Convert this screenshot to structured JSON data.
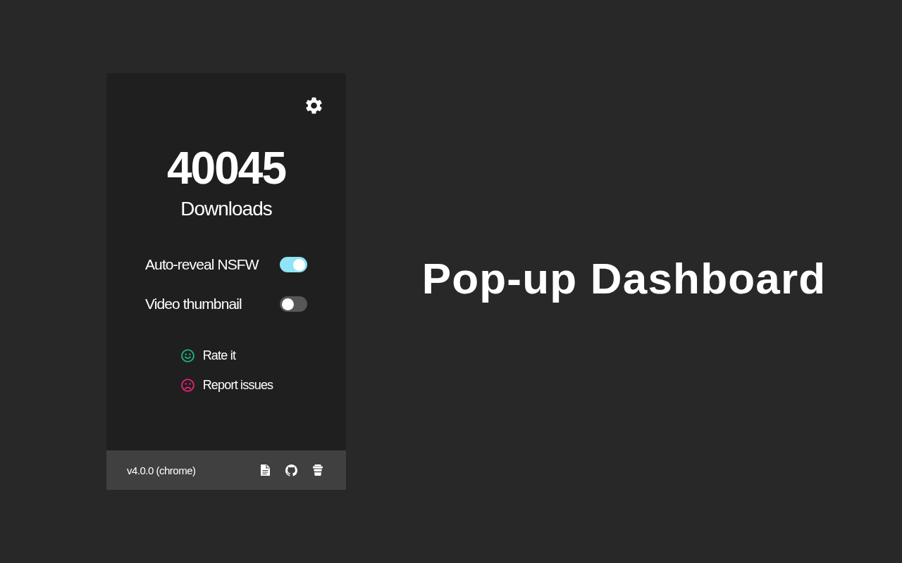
{
  "panel": {
    "count": "40045",
    "count_label": "Downloads",
    "toggles": [
      {
        "label": "Auto-reveal NSFW",
        "on": true
      },
      {
        "label": "Video thumbnail",
        "on": false
      }
    ],
    "links": [
      {
        "label": "Rate it",
        "kind": "happy",
        "color": "#1db57e"
      },
      {
        "label": "Report issues",
        "kind": "sad",
        "color": "#e8227a"
      }
    ],
    "footer": {
      "version": "v4.0.0 (chrome)"
    }
  },
  "caption": "Pop-up Dashboard"
}
